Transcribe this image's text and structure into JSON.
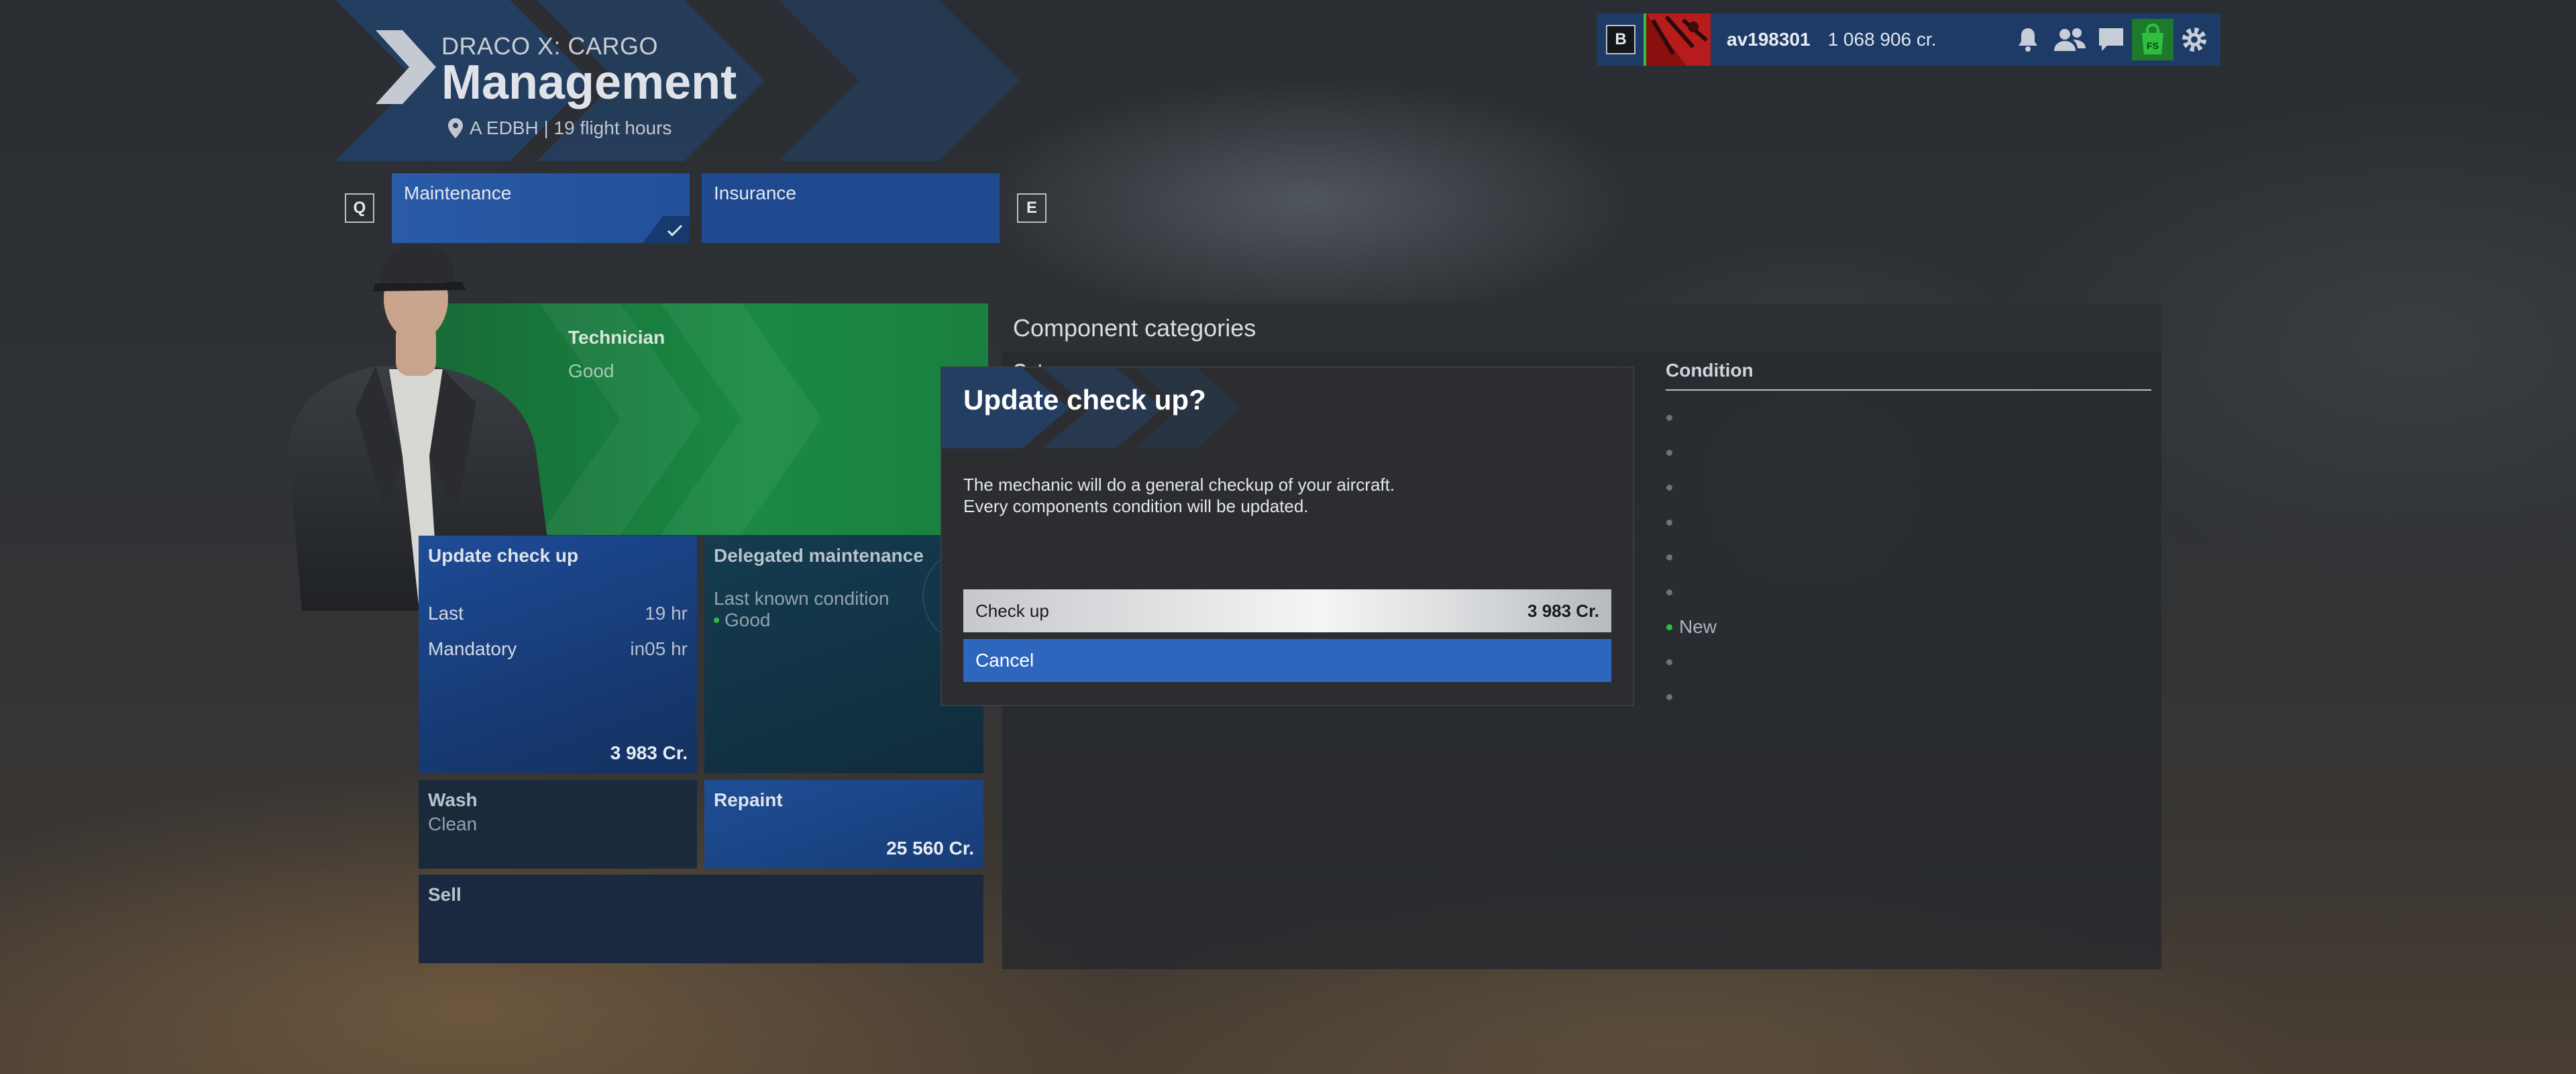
{
  "header": {
    "aircraft": "DRACO X: CARGO",
    "title": "Management",
    "location": "A EDBH | 19 flight hours"
  },
  "topbar": {
    "key_b": "B",
    "username": "av198301",
    "credits": "1 068 906 cr.",
    "icons": [
      "bell-icon",
      "friends-icon",
      "chat-icon",
      "marketplace-icon",
      "settings-icon"
    ],
    "marketplace_label": "FS"
  },
  "tabs": {
    "key_prev": "Q",
    "key_next": "E",
    "items": [
      {
        "label": "Maintenance",
        "selected": true
      },
      {
        "label": "Insurance",
        "selected": false
      }
    ]
  },
  "technician": {
    "title": "Technician",
    "value": "Good"
  },
  "cards": {
    "update": {
      "title": "Update check up",
      "last_label": "Last",
      "last_value": "19 hr",
      "mandatory_label": "Mandatory",
      "mandatory_value": "in05 hr",
      "price": "3 983 Cr."
    },
    "delegated": {
      "title": "Delegated maintenance",
      "subtitle": "Last known condition",
      "value": "Good"
    },
    "wash": {
      "title": "Wash",
      "value": "Clean"
    },
    "repaint": {
      "title": "Repaint",
      "price": "25 560 Cr."
    },
    "sell": {
      "title": "Sell"
    }
  },
  "components": {
    "title": "Component categories",
    "category_header": "Cat",
    "condition_header": "Condition",
    "new_label": "New"
  },
  "modal": {
    "title": "Update check up?",
    "line1": "The mechanic will do a general checkup of your aircraft.",
    "line2": "Every components condition will be updated.",
    "confirm_label": "Check up",
    "confirm_price": "3 983 Cr.",
    "cancel_label": "Cancel"
  },
  "colors": {
    "accent_blue": "#2f66bd",
    "technician_green": "#1a8a44",
    "status_green": "#2fbf3f"
  }
}
